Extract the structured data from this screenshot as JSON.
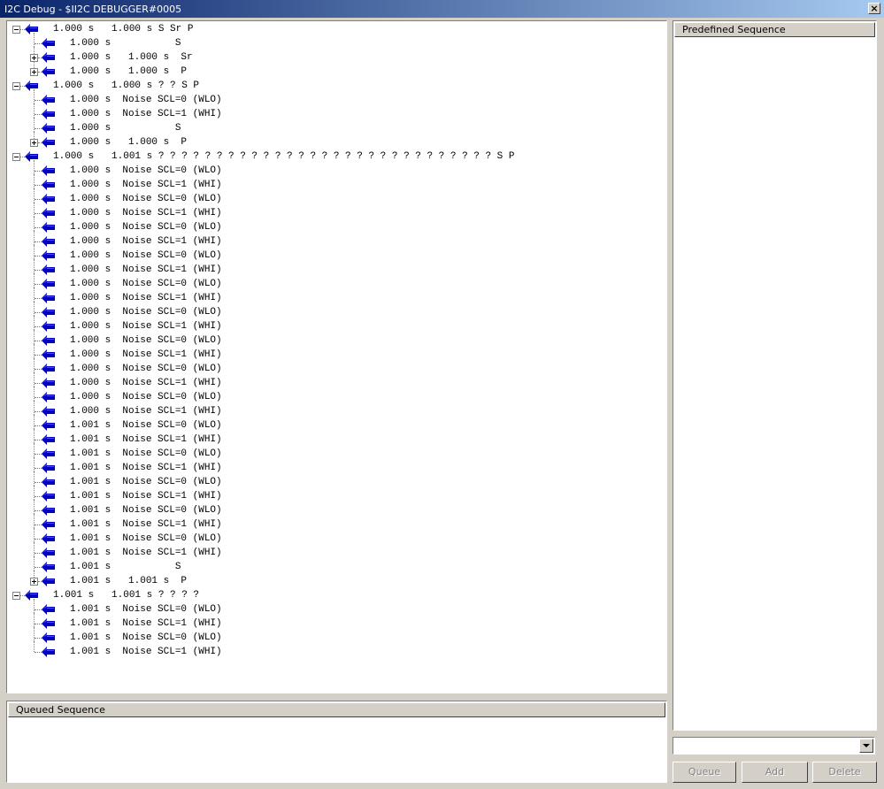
{
  "window": {
    "title": "I2C Debug - $II2C DEBUGGER#0005",
    "close_icon": "close-icon"
  },
  "tree_nodes": [
    {
      "level": 0,
      "toggle": "minus",
      "text": "1.000 s   1.000 s S Sr P"
    },
    {
      "level": 1,
      "toggle": "none",
      "text": "1.000 s           S"
    },
    {
      "level": 1,
      "toggle": "plus",
      "text": "1.000 s   1.000 s  Sr"
    },
    {
      "level": 1,
      "toggle": "plus",
      "text": "1.000 s   1.000 s  P"
    },
    {
      "level": 0,
      "toggle": "minus",
      "text": "1.000 s   1.000 s ? ? S P"
    },
    {
      "level": 1,
      "toggle": "none",
      "text": "1.000 s  Noise SCL=0 (WLO)"
    },
    {
      "level": 1,
      "toggle": "none",
      "text": "1.000 s  Noise SCL=1 (WHI)"
    },
    {
      "level": 1,
      "toggle": "none",
      "text": "1.000 s           S"
    },
    {
      "level": 1,
      "toggle": "plus",
      "text": "1.000 s   1.000 s  P"
    },
    {
      "level": 0,
      "toggle": "minus",
      "text": "1.000 s   1.001 s ? ? ? ? ? ? ? ? ? ? ? ? ? ? ? ? ? ? ? ? ? ? ? ? ? ? ? ? ? S P"
    },
    {
      "level": 1,
      "toggle": "none",
      "text": "1.000 s  Noise SCL=0 (WLO)"
    },
    {
      "level": 1,
      "toggle": "none",
      "text": "1.000 s  Noise SCL=1 (WHI)"
    },
    {
      "level": 1,
      "toggle": "none",
      "text": "1.000 s  Noise SCL=0 (WLO)"
    },
    {
      "level": 1,
      "toggle": "none",
      "text": "1.000 s  Noise SCL=1 (WHI)"
    },
    {
      "level": 1,
      "toggle": "none",
      "text": "1.000 s  Noise SCL=0 (WLO)"
    },
    {
      "level": 1,
      "toggle": "none",
      "text": "1.000 s  Noise SCL=1 (WHI)"
    },
    {
      "level": 1,
      "toggle": "none",
      "text": "1.000 s  Noise SCL=0 (WLO)"
    },
    {
      "level": 1,
      "toggle": "none",
      "text": "1.000 s  Noise SCL=1 (WHI)"
    },
    {
      "level": 1,
      "toggle": "none",
      "text": "1.000 s  Noise SCL=0 (WLO)"
    },
    {
      "level": 1,
      "toggle": "none",
      "text": "1.000 s  Noise SCL=1 (WHI)"
    },
    {
      "level": 1,
      "toggle": "none",
      "text": "1.000 s  Noise SCL=0 (WLO)"
    },
    {
      "level": 1,
      "toggle": "none",
      "text": "1.000 s  Noise SCL=1 (WHI)"
    },
    {
      "level": 1,
      "toggle": "none",
      "text": "1.000 s  Noise SCL=0 (WLO)"
    },
    {
      "level": 1,
      "toggle": "none",
      "text": "1.000 s  Noise SCL=1 (WHI)"
    },
    {
      "level": 1,
      "toggle": "none",
      "text": "1.000 s  Noise SCL=0 (WLO)"
    },
    {
      "level": 1,
      "toggle": "none",
      "text": "1.000 s  Noise SCL=1 (WHI)"
    },
    {
      "level": 1,
      "toggle": "none",
      "text": "1.000 s  Noise SCL=0 (WLO)"
    },
    {
      "level": 1,
      "toggle": "none",
      "text": "1.000 s  Noise SCL=1 (WHI)"
    },
    {
      "level": 1,
      "toggle": "none",
      "text": "1.001 s  Noise SCL=0 (WLO)"
    },
    {
      "level": 1,
      "toggle": "none",
      "text": "1.001 s  Noise SCL=1 (WHI)"
    },
    {
      "level": 1,
      "toggle": "none",
      "text": "1.001 s  Noise SCL=0 (WLO)"
    },
    {
      "level": 1,
      "toggle": "none",
      "text": "1.001 s  Noise SCL=1 (WHI)"
    },
    {
      "level": 1,
      "toggle": "none",
      "text": "1.001 s  Noise SCL=0 (WLO)"
    },
    {
      "level": 1,
      "toggle": "none",
      "text": "1.001 s  Noise SCL=1 (WHI)"
    },
    {
      "level": 1,
      "toggle": "none",
      "text": "1.001 s  Noise SCL=0 (WLO)"
    },
    {
      "level": 1,
      "toggle": "none",
      "text": "1.001 s  Noise SCL=1 (WHI)"
    },
    {
      "level": 1,
      "toggle": "none",
      "text": "1.001 s  Noise SCL=0 (WLO)"
    },
    {
      "level": 1,
      "toggle": "none",
      "text": "1.001 s  Noise SCL=1 (WHI)"
    },
    {
      "level": 1,
      "toggle": "none",
      "text": "1.001 s           S"
    },
    {
      "level": 1,
      "toggle": "plus",
      "text": "1.001 s   1.001 s  P"
    },
    {
      "level": 0,
      "toggle": "minus",
      "text": "1.001 s   1.001 s ? ? ? ?"
    },
    {
      "level": 1,
      "toggle": "none",
      "text": "1.001 s  Noise SCL=0 (WLO)"
    },
    {
      "level": 1,
      "toggle": "none",
      "text": "1.001 s  Noise SCL=1 (WHI)"
    },
    {
      "level": 1,
      "toggle": "none",
      "text": "1.001 s  Noise SCL=0 (WLO)"
    },
    {
      "level": 1,
      "toggle": "none",
      "text": "1.001 s  Noise SCL=1 (WHI)"
    }
  ],
  "predefined": {
    "header": "Predefined Sequence"
  },
  "queued": {
    "header": "Queued Sequence"
  },
  "sequence_select": {
    "value": ""
  },
  "buttons": {
    "queue": "Queue",
    "add": "Add",
    "delete": "Delete"
  },
  "colors": {
    "arrow": "#0000c0",
    "titlebar": "#0a246a"
  }
}
